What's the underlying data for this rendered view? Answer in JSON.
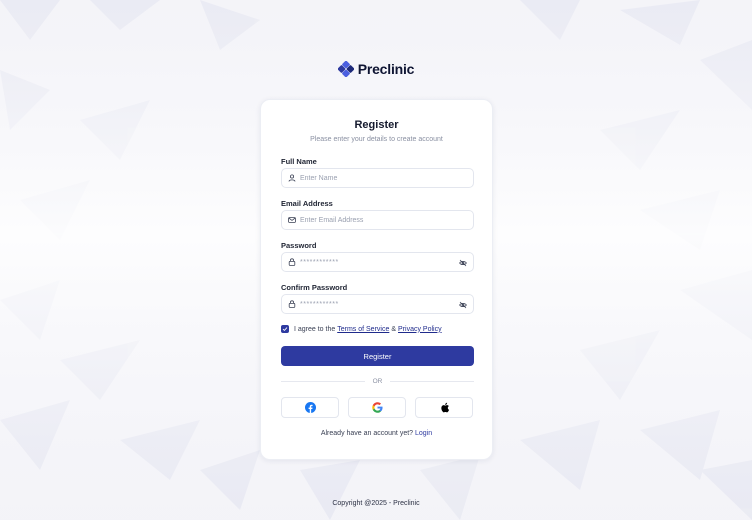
{
  "brand": {
    "name": "Preclinic",
    "logo_icon": "medical-cross-logo"
  },
  "card": {
    "title": "Register",
    "subtitle": "Please enter your details to create account"
  },
  "fields": {
    "full_name": {
      "label": "Full Name",
      "placeholder": "Enter Name",
      "icon": "user-icon"
    },
    "email": {
      "label": "Email Address",
      "placeholder": "Enter Email Address",
      "icon": "mail-icon"
    },
    "password": {
      "label": "Password",
      "value": "************",
      "icon": "lock-icon",
      "toggle_icon": "eye-off-icon"
    },
    "confirm_password": {
      "label": "Confirm Password",
      "value": "************",
      "icon": "lock-icon",
      "toggle_icon": "eye-off-icon"
    }
  },
  "agree": {
    "checked": true,
    "prefix": "I agree to the",
    "terms": "Terms of Service",
    "amp": "&",
    "privacy": "Privacy Policy"
  },
  "register_button": "Register",
  "divider": "OR",
  "social": [
    {
      "name": "facebook",
      "icon": "facebook-icon",
      "color": "#1877F2"
    },
    {
      "name": "google",
      "icon": "google-icon",
      "color": "#4285F4"
    },
    {
      "name": "apple",
      "icon": "apple-icon",
      "color": "#000000"
    }
  ],
  "login_prompt": {
    "text": "Already have an account yet?",
    "link": "Login"
  },
  "footer": "Copyright @2025 - Preclinic",
  "colors": {
    "primary": "#2E3AA0",
    "accent": "#4B5FE0",
    "background": "#F4F4F8"
  }
}
